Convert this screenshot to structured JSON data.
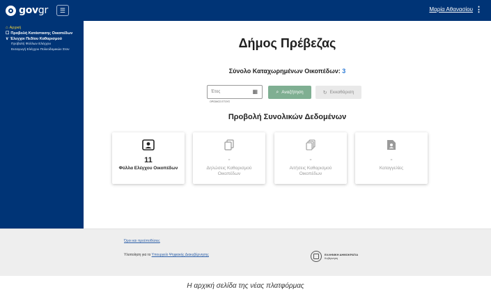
{
  "header": {
    "logo_text": "gov",
    "logo_suffix": "gr",
    "menu_icon": "☰",
    "user_name": "Μαρία Αθανασίου",
    "kebab_icon": "⋮"
  },
  "sidebar": {
    "items": [
      {
        "label": "Αρχική",
        "icon": "⌂"
      },
      {
        "label": "Προβολή Κατάστασης Οικοπέδων",
        "icon": "☐"
      },
      {
        "label": "Έλεγχοι Πεδίου Καθαρισμού",
        "icon": "∨"
      }
    ],
    "subitems": [
      {
        "label": "Προβολή Φύλλων Ελέγχου"
      },
      {
        "label": "Εισαγωγή Ελέγχου Πολεοδομικών Στον"
      }
    ]
  },
  "main": {
    "title": "Δήμος Πρέβεζας",
    "total_label": "Σύνολο Καταχωρημένων Οικοπέδων: ",
    "total_value": "3",
    "year_placeholder": "Έτος",
    "year_help": "ΟΡΙΣΜΟΣ ΕΤΟΥΣ",
    "search_label": "Αναζήτηση",
    "clear_label": "Εκκαθάριση",
    "subtitle": "Προβολή Συνολικών Δεδομένων",
    "cards": [
      {
        "value": "11",
        "label": "Φύλλα Ελέγχου Οικοπέδων",
        "icon": "person-doc-icon"
      },
      {
        "value": "-",
        "label": "Δηλώσεις Καθαρισμού Οικοπέδων",
        "icon": "copy-doc-icon"
      },
      {
        "value": "-",
        "label": "Αιτήσεις Καθαρισμού Οικοπέδων",
        "icon": "stack-doc-icon"
      },
      {
        "value": "-",
        "label": "Καταγγελίες",
        "icon": "person-file-icon"
      }
    ]
  },
  "footer": {
    "terms_link": "Όροι και προϋποθέσεις",
    "impl_text": "Υλοποίηση για το ",
    "impl_link": "Υπουργείο Ψηφιακής Διακυβέρνησης",
    "gov_line1": "ΕΛΛΗΝΙΚΗ ΔΗΜΟΚΡΑΤΙΑ",
    "gov_line2": "Κυβέρνηση"
  },
  "caption": "Η αρχική σελίδα της νέας πλατφόρμας",
  "colors": {
    "brand": "#003476",
    "active_nav": "#f3d53b",
    "search_button": "#7faf92",
    "total_value": "#2c7bd6"
  }
}
